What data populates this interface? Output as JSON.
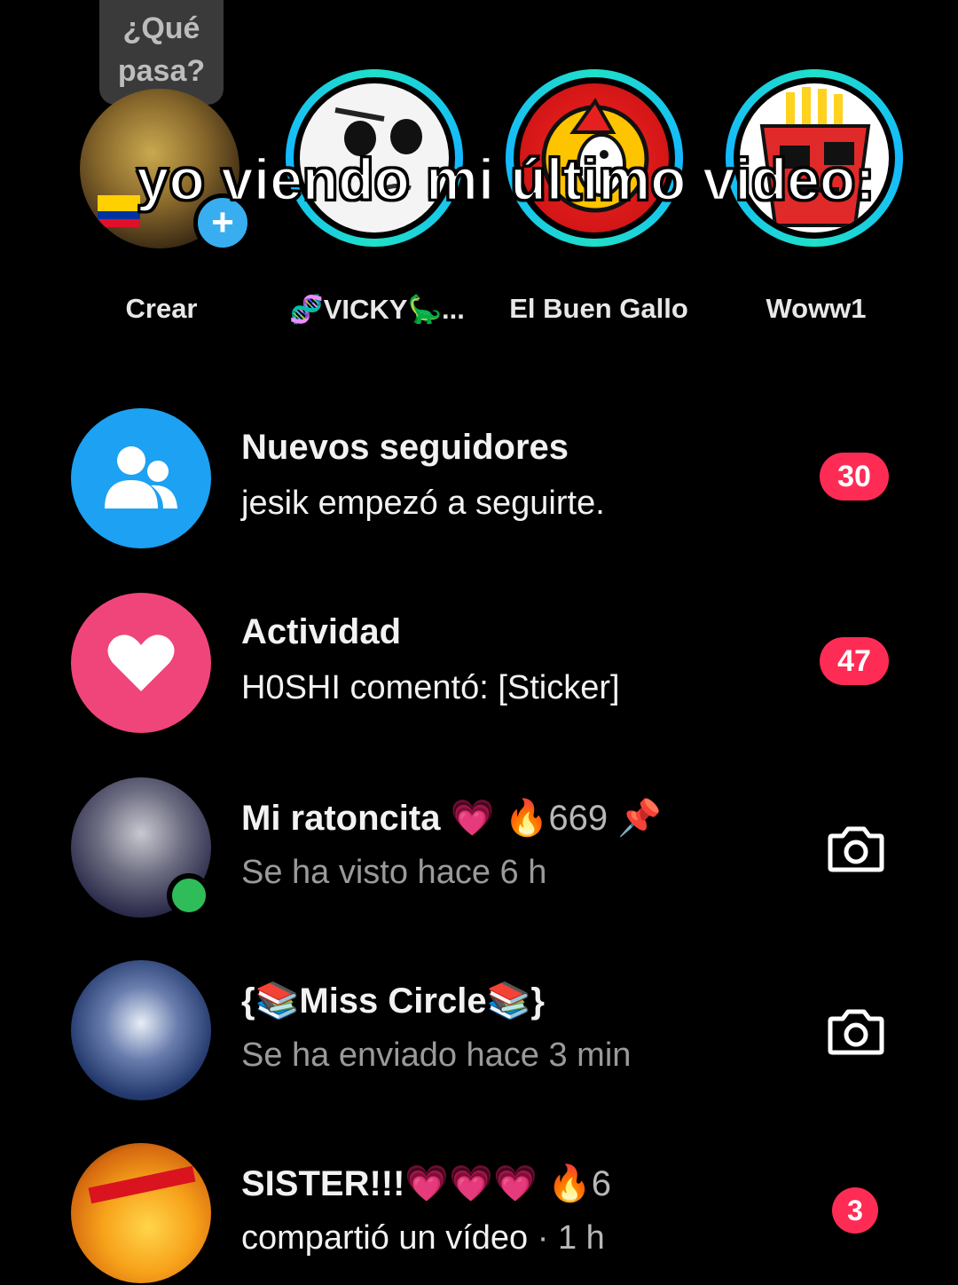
{
  "bubble": {
    "text": "¿Qué pasa?"
  },
  "caption": {
    "text": "yo viendo mi último video:"
  },
  "stories": [
    {
      "label": "Crear"
    },
    {
      "label": "🧬VICKY🦕..."
    },
    {
      "label": "El Buen Gallo"
    },
    {
      "label": "Woww1"
    }
  ],
  "inbox": {
    "new_followers": {
      "title": "Nuevos seguidores",
      "subtitle": "jesik empezó a seguirte.",
      "badge": "30",
      "icon": "users-icon",
      "color": "#1da1f2"
    },
    "activity": {
      "title": "Actividad",
      "subtitle": "H0SHI comentó: [Sticker]",
      "badge": "47",
      "icon": "heart-icon",
      "color": "#f0457a"
    },
    "chats": [
      {
        "name": "Mi ratoncita",
        "emoji": "💗",
        "streak": "669",
        "status": "Se ha visto hace 6 h",
        "action": "camera-icon"
      },
      {
        "name": "{📚Miss Circle📚}",
        "status": "Se ha enviado hace 3 min",
        "action": "camera-icon"
      },
      {
        "name": "SISTER!!!💗💗💗",
        "streak": "6",
        "status": "compartió un vídeo",
        "time": "· 1 h",
        "badge": "3"
      }
    ]
  },
  "colors": {
    "badge": "#fe2c55",
    "online": "#2ebd59",
    "ring": "#1fe0c8"
  }
}
